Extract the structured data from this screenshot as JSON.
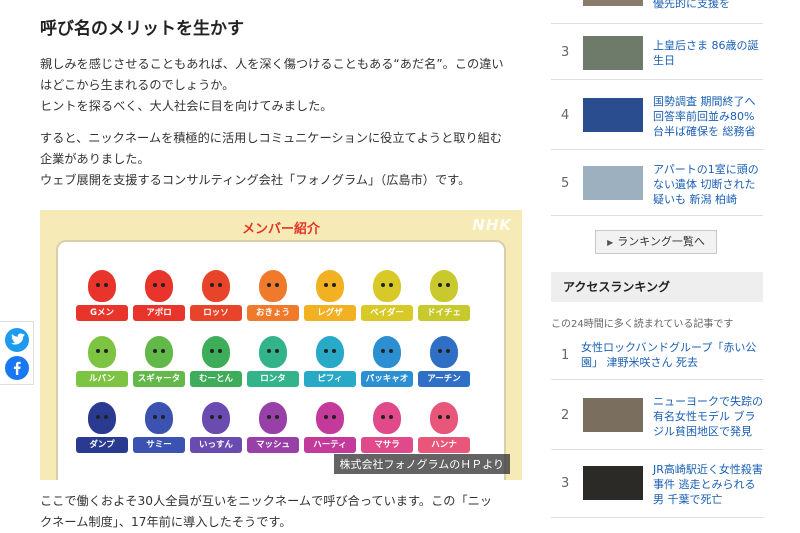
{
  "article": {
    "title": "呼び名のメリットを生かす",
    "para1": [
      "親しみを感じさせることもあれば、人を深く傷つけることもある“あだ名”。この違い",
      "はどこから生まれるのでしょうか。",
      "ヒントを探るべく、大人社会に目を向けてみました。"
    ],
    "para2": [
      "すると、ニックネームを積極的に活用しコミュニケーションに役立てようと取り組む",
      "企業がありました。",
      "ウェブ展開を支援するコンサルティング会社「フォノグラム」（広島市）です。"
    ],
    "para3": [
      "ここで働くおよそ30人全員が互いをニックネームで呼び合っています。この「ニッ",
      "クネーム制度」、17年前に導入したそうです。"
    ]
  },
  "figure": {
    "title": "メンバー紹介",
    "watermark": "NHK",
    "caption": "株式会社フォノグラムのＨＰより",
    "members": [
      [
        {
          "name": "Gメン",
          "color": "#e8342a"
        },
        {
          "name": "アポロ",
          "color": "#e8342a"
        },
        {
          "name": "ロッソ",
          "color": "#e8442a"
        },
        {
          "name": "おきょう",
          "color": "#f07a2c"
        },
        {
          "name": "レグザ",
          "color": "#f2b023"
        },
        {
          "name": "ベイダー",
          "color": "#d8c928"
        },
        {
          "name": "ドイチェ",
          "color": "#c7c92c"
        }
      ],
      [
        {
          "name": "ルパン",
          "color": "#7cc442"
        },
        {
          "name": "スギャータ",
          "color": "#62b94a"
        },
        {
          "name": "むーとん",
          "color": "#3ead5a"
        },
        {
          "name": "ロンタ",
          "color": "#33b38a"
        },
        {
          "name": "ピフィ",
          "color": "#29a9c8"
        },
        {
          "name": "パッキャオ",
          "color": "#2b8fd1"
        },
        {
          "name": "アーチン",
          "color": "#2f6fc6"
        }
      ],
      [
        {
          "name": "ダンプ",
          "color": "#2a3a90"
        },
        {
          "name": "サミー",
          "color": "#3b52b0"
        },
        {
          "name": "いっすん",
          "color": "#6a4bb0"
        },
        {
          "name": "マッシュ",
          "color": "#9840a8"
        },
        {
          "name": "ハーティ",
          "color": "#c43a9a"
        },
        {
          "name": "マサラ",
          "color": "#e04a8a"
        },
        {
          "name": "ハンナ",
          "color": "#e8567a"
        }
      ]
    ]
  },
  "sidebar": {
    "ranking": [
      {
        "num": "",
        "text": [
          "優先的に支援を"
        ],
        "thumb": "#8a7b6a"
      },
      {
        "num": "3",
        "text": [
          "上皇后さま 86歳の誕",
          "生日"
        ],
        "thumb": "#6f7b6a"
      },
      {
        "num": "4",
        "text": [
          "国勢調査 期間終了へ",
          "回答率前回並み80%",
          "台半ば確保を 総務省"
        ],
        "thumb": "#2a4d8f"
      },
      {
        "num": "5",
        "text": [
          "アパートの1室に頭の",
          "ない遺体 切断された",
          "疑いも 新潟 柏崎"
        ],
        "thumb": "#9cb0bf"
      }
    ],
    "ranking_button": "ランキング一覧へ",
    "access_title": "アクセスランキング",
    "access_sub": "この24時間に多く読まれている記事です",
    "access": [
      {
        "num": "1",
        "text": [
          "女性ロックバンドグループ「赤い公",
          "園」 津野米咲さん 死去"
        ]
      },
      {
        "num": "2",
        "text": [
          "ニューヨークで失踪の",
          "有名女性モデル ブラ",
          "ジル貧困地区で発見"
        ],
        "thumb": "#7a6e5f"
      },
      {
        "num": "3",
        "text": [
          "JR高崎駅近く女性殺害",
          "事件 逃走とみられる",
          "男 千葉で死亡"
        ],
        "thumb": "#2c2a26"
      }
    ]
  },
  "icons": {
    "twitter": "twitter-icon",
    "facebook": "facebook-icon"
  },
  "colors": {
    "link": "#1a5fb4",
    "figure_title": "#e2352a",
    "figure_bg": "#f6ebb7"
  }
}
